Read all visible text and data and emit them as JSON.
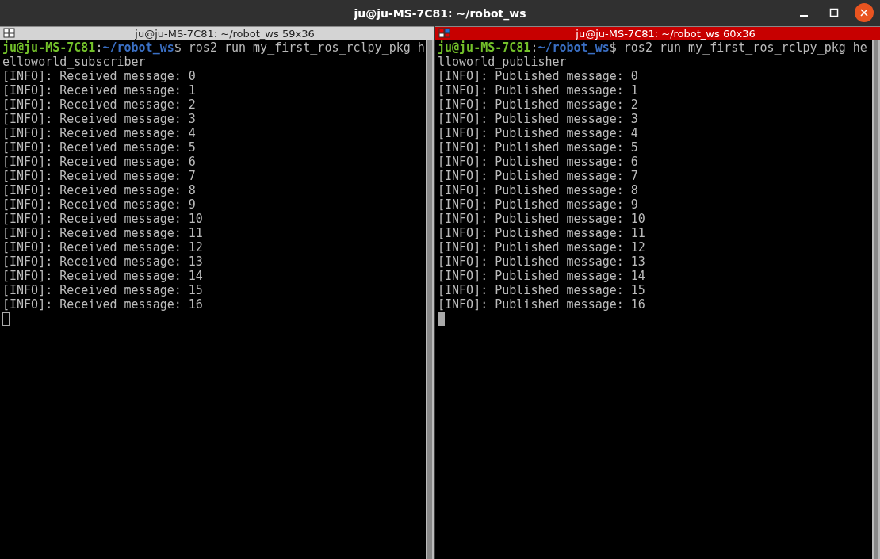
{
  "window": {
    "title": "ju@ju-MS-7C81: ~/robot_ws"
  },
  "panes": [
    {
      "title": "ju@ju-MS-7C81: ~/robot_ws 59x36",
      "focused": false,
      "prompt": {
        "user": "ju@ju-MS-7C81",
        "separator": ":",
        "path": "~/robot_ws",
        "command": "$ ros2 run my_first_ros_rclpy_pkg h"
      },
      "lines": [
        "elloworld_subscriber",
        "[INFO]: Received message: 0",
        "[INFO]: Received message: 1",
        "[INFO]: Received message: 2",
        "[INFO]: Received message: 3",
        "[INFO]: Received message: 4",
        "[INFO]: Received message: 5",
        "[INFO]: Received message: 6",
        "[INFO]: Received message: 7",
        "[INFO]: Received message: 8",
        "[INFO]: Received message: 9",
        "[INFO]: Received message: 10",
        "[INFO]: Received message: 11",
        "[INFO]: Received message: 12",
        "[INFO]: Received message: 13",
        "[INFO]: Received message: 14",
        "[INFO]: Received message: 15",
        "[INFO]: Received message: 16"
      ]
    },
    {
      "title": "ju@ju-MS-7C81: ~/robot_ws 60x36",
      "focused": true,
      "prompt": {
        "user": "ju@ju-MS-7C81",
        "separator": ":",
        "path": "~/robot_ws",
        "command": "$ ros2 run my_first_ros_rclpy_pkg he"
      },
      "lines": [
        "lloworld_publisher",
        "[INFO]: Published message: 0",
        "[INFO]: Published message: 1",
        "[INFO]: Published message: 2",
        "[INFO]: Published message: 3",
        "[INFO]: Published message: 4",
        "[INFO]: Published message: 5",
        "[INFO]: Published message: 6",
        "[INFO]: Published message: 7",
        "[INFO]: Published message: 8",
        "[INFO]: Published message: 9",
        "[INFO]: Published message: 10",
        "[INFO]: Published message: 11",
        "[INFO]: Published message: 12",
        "[INFO]: Published message: 13",
        "[INFO]: Published message: 14",
        "[INFO]: Published message: 15",
        "[INFO]: Published message: 16"
      ]
    }
  ]
}
